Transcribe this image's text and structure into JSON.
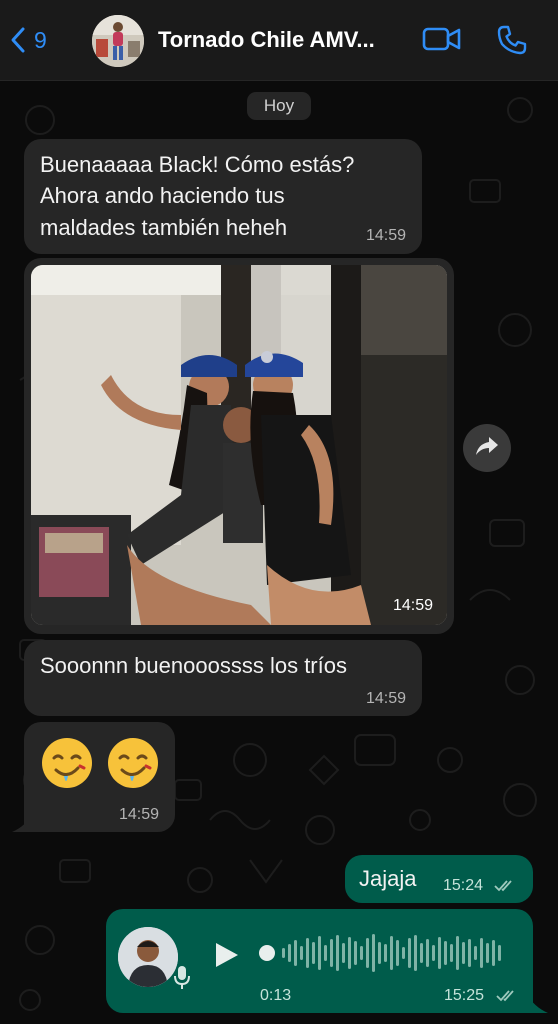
{
  "header": {
    "back_count": "9",
    "title": "Tornado Chile AMV...",
    "icons": [
      "back-chevron-icon",
      "video-call-icon",
      "phone-icon"
    ],
    "accent": "#2f8df6"
  },
  "date_separator": "Hoy",
  "messages": [
    {
      "direction": "incoming",
      "lines": [
        "Buenaaaaa Black! Cómo estás?",
        "Ahora ando haciendo tus",
        "maldades también heheh"
      ],
      "time": "14:59"
    },
    {
      "direction": "incoming",
      "type": "photo",
      "time": "14:59"
    },
    {
      "direction": "incoming",
      "text": "Sooonnn buenooossss los tríos",
      "time": "14:59"
    },
    {
      "direction": "incoming",
      "emoji": [
        "🤤",
        "🤤"
      ],
      "time": "14:59"
    },
    {
      "direction": "outgoing",
      "text": "Jajaja",
      "time": "15:24",
      "status": "read"
    },
    {
      "direction": "outgoing",
      "type": "voice",
      "duration": "0:13",
      "time": "15:25",
      "status": "read"
    }
  ],
  "colors": {
    "incoming_bubble": "#262626",
    "outgoing_bubble": "#005c4b",
    "background": "#0b0b0b"
  }
}
